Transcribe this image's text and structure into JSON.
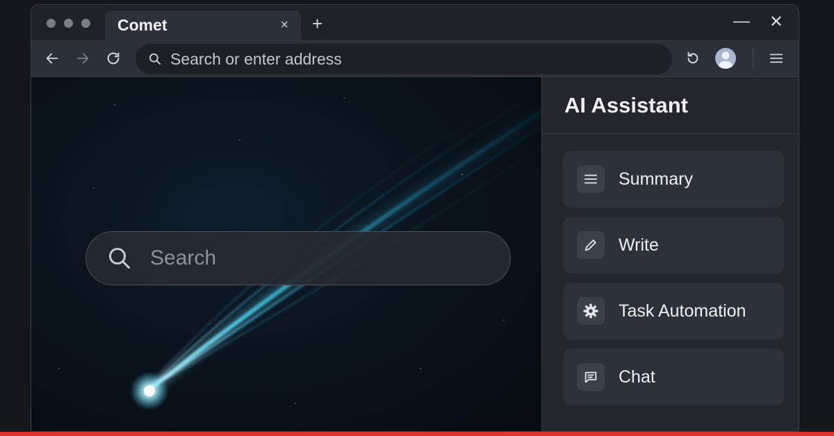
{
  "browser": {
    "tab_title": "Comet",
    "tab_close": "×",
    "new_tab": "+",
    "minimize": "—",
    "close": "✕",
    "address_placeholder": "Search or enter address"
  },
  "content": {
    "search_placeholder": "Search"
  },
  "panel": {
    "title": "AI Assistant",
    "items": [
      {
        "label": "Summary",
        "icon": "lines-icon"
      },
      {
        "label": "Write",
        "icon": "pencil-icon"
      },
      {
        "label": "Task Automation",
        "icon": "gear-icon"
      },
      {
        "label": "Chat",
        "icon": "chat-bubble-icon"
      }
    ]
  },
  "colors": {
    "background": "#15171c",
    "window": "#23262d",
    "accent_bar": "#e0322e",
    "comet": "#5fd6f0"
  }
}
